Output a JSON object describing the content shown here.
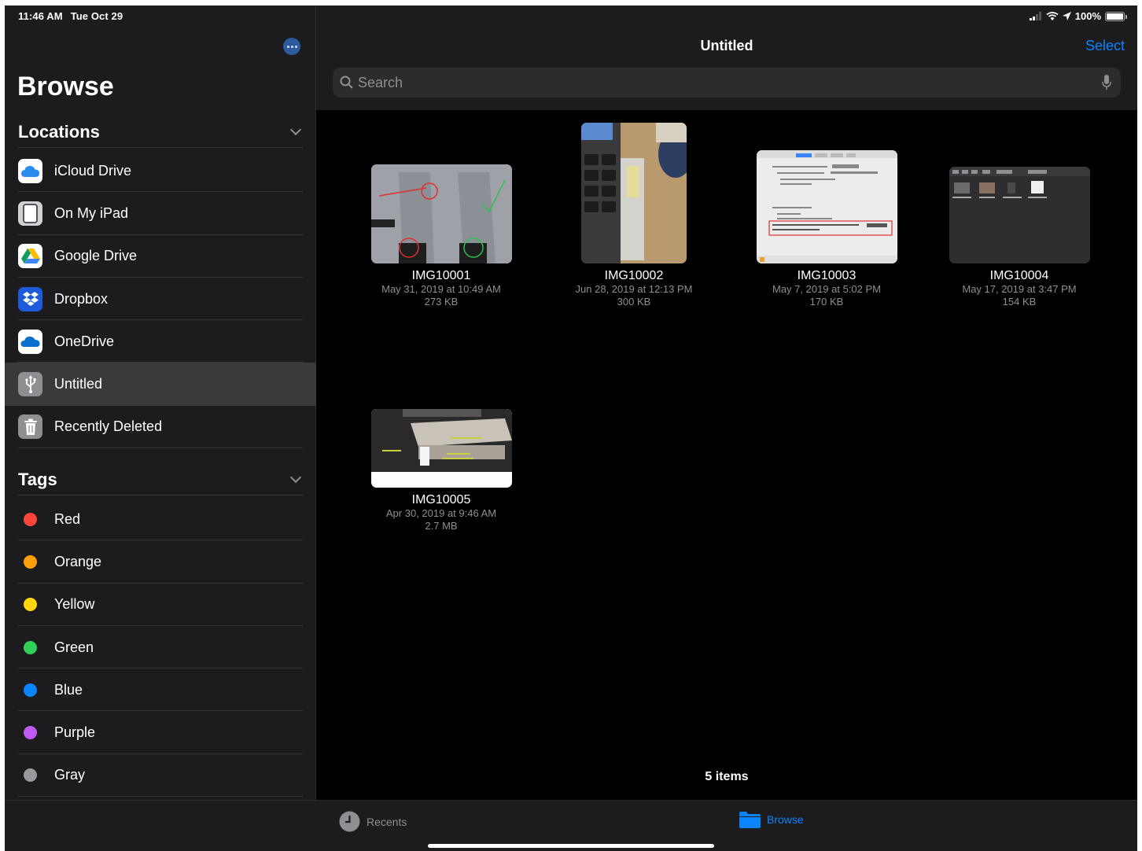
{
  "status": {
    "time": "11:46 AM",
    "date": "Tue Oct 29",
    "battery": "100%"
  },
  "sidebar": {
    "title": "Browse",
    "locations_header": "Locations",
    "locations": [
      {
        "label": "iCloud Drive",
        "icon": "icloud-icon"
      },
      {
        "label": "On My iPad",
        "icon": "ipad-icon"
      },
      {
        "label": "Google Drive",
        "icon": "google-drive-icon"
      },
      {
        "label": "Dropbox",
        "icon": "dropbox-icon"
      },
      {
        "label": "OneDrive",
        "icon": "onedrive-icon"
      },
      {
        "label": "Untitled",
        "icon": "usb-icon",
        "selected": true
      },
      {
        "label": "Recently Deleted",
        "icon": "trash-icon"
      }
    ],
    "tags_header": "Tags",
    "tags": [
      {
        "label": "Red",
        "color": "#ff453a"
      },
      {
        "label": "Orange",
        "color": "#ff9f0a"
      },
      {
        "label": "Yellow",
        "color": "#ffd60a"
      },
      {
        "label": "Green",
        "color": "#30d158"
      },
      {
        "label": "Blue",
        "color": "#0a84ff"
      },
      {
        "label": "Purple",
        "color": "#bf5af2"
      },
      {
        "label": "Gray",
        "color": "#98989d"
      }
    ]
  },
  "main": {
    "title": "Untitled",
    "select_label": "Select",
    "search_placeholder": "Search",
    "files": [
      {
        "name": "IMG10001",
        "date": "May 31, 2019 at 10:49 AM",
        "size": "273 KB"
      },
      {
        "name": "IMG10002",
        "date": "Jun 28, 2019 at 12:13 PM",
        "size": "300 KB"
      },
      {
        "name": "IMG10003",
        "date": "May 7, 2019 at 5:02 PM",
        "size": "170 KB"
      },
      {
        "name": "IMG10004",
        "date": "May 17, 2019 at 3:47 PM",
        "size": "154 KB"
      },
      {
        "name": "IMG10005",
        "date": "Apr 30, 2019 at 9:46 AM",
        "size": "2.7 MB"
      }
    ],
    "items_count": "5 items"
  },
  "tabbar": {
    "recents_label": "Recents",
    "browse_label": "Browse"
  },
  "colors": {
    "accent": "#0a84ff",
    "sidebar_bg": "#1c1c1e",
    "selected_row": "#3a3a3c"
  }
}
